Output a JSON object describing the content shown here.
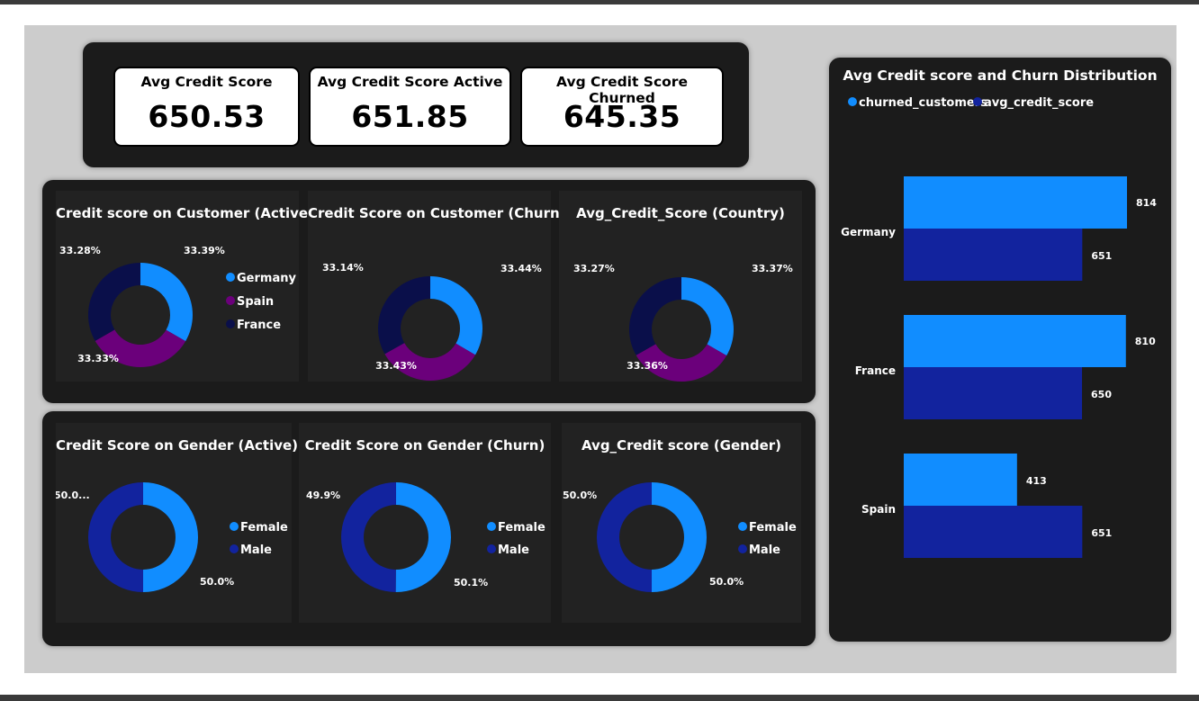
{
  "colors": {
    "bright_blue": "#118DFF",
    "purple": "#6B007B",
    "navy": "#12239E",
    "dark_navy": "#0A0F4A",
    "panel_bg": "#1b1b1b",
    "card_bg": "#222222",
    "canvas_bg": "#cccccc"
  },
  "kpis": [
    {
      "title": "Avg Credit Score",
      "value": "650.53"
    },
    {
      "title": "Avg Credit Score Active",
      "value": "651.85"
    },
    {
      "title": "Avg Credit Score Churned",
      "value": "645.35"
    }
  ],
  "country_donuts": {
    "legend": [
      "Germany",
      "Spain",
      "France"
    ],
    "charts": [
      {
        "title": "Credit score on Customer (Active)",
        "labels": [
          "33.39%",
          "33.33%",
          "33.28%"
        ],
        "values": [
          33.39,
          33.33,
          33.28
        ]
      },
      {
        "title": "Credit Score on Customer (Churn)",
        "labels": [
          "33.44%",
          "33.43%",
          "33.14%"
        ],
        "values": [
          33.44,
          33.43,
          33.14
        ]
      },
      {
        "title": "Avg_Credit_Score (Country)",
        "labels": [
          "33.37%",
          "33.36%",
          "33.27%"
        ],
        "values": [
          33.37,
          33.36,
          33.27
        ]
      }
    ]
  },
  "gender_donuts": {
    "legend": [
      "Female",
      "Male"
    ],
    "charts": [
      {
        "title": "Credit Score on Gender (Active)",
        "labels": [
          "50.0%",
          "50.0..."
        ],
        "values": [
          50.0,
          50.0
        ]
      },
      {
        "title": "Credit Score on Gender (Churn)",
        "labels": [
          "50.1%",
          "49.9%"
        ],
        "values": [
          50.1,
          49.9
        ]
      },
      {
        "title": "Avg_Credit score (Gender)",
        "labels": [
          "50.0%",
          "50.0%"
        ],
        "values": [
          50.0,
          50.0
        ]
      }
    ]
  },
  "bar_panel": {
    "title": "Avg Credit score and Churn Distribution",
    "legend": [
      "churned_customers",
      "avg_credit_score"
    ]
  },
  "chart_data": [
    {
      "type": "pie",
      "title": "Credit score on Customer (Active)",
      "categories": [
        "Germany",
        "Spain",
        "France"
      ],
      "values": [
        33.39,
        33.33,
        33.28
      ]
    },
    {
      "type": "pie",
      "title": "Credit Score on Customer (Churn)",
      "categories": [
        "Germany",
        "Spain",
        "France"
      ],
      "values": [
        33.44,
        33.43,
        33.14
      ]
    },
    {
      "type": "pie",
      "title": "Avg_Credit_Score (Country)",
      "categories": [
        "Germany",
        "Spain",
        "France"
      ],
      "values": [
        33.37,
        33.36,
        33.27
      ]
    },
    {
      "type": "pie",
      "title": "Credit Score on Gender (Active)",
      "categories": [
        "Female",
        "Male"
      ],
      "values": [
        50.0,
        50.0
      ]
    },
    {
      "type": "pie",
      "title": "Credit Score on Gender (Churn)",
      "categories": [
        "Female",
        "Male"
      ],
      "values": [
        50.1,
        49.9
      ]
    },
    {
      "type": "pie",
      "title": "Avg_Credit score (Gender)",
      "categories": [
        "Female",
        "Male"
      ],
      "values": [
        50.0,
        50.0
      ]
    },
    {
      "type": "bar",
      "orientation": "horizontal",
      "title": "Avg Credit score and Churn Distribution",
      "categories": [
        "Germany",
        "France",
        "Spain"
      ],
      "series": [
        {
          "name": "churned_customers",
          "values": [
            814,
            810,
            413
          ]
        },
        {
          "name": "avg_credit_score",
          "values": [
            651,
            650,
            651
          ]
        }
      ],
      "legend": "top-left"
    }
  ]
}
